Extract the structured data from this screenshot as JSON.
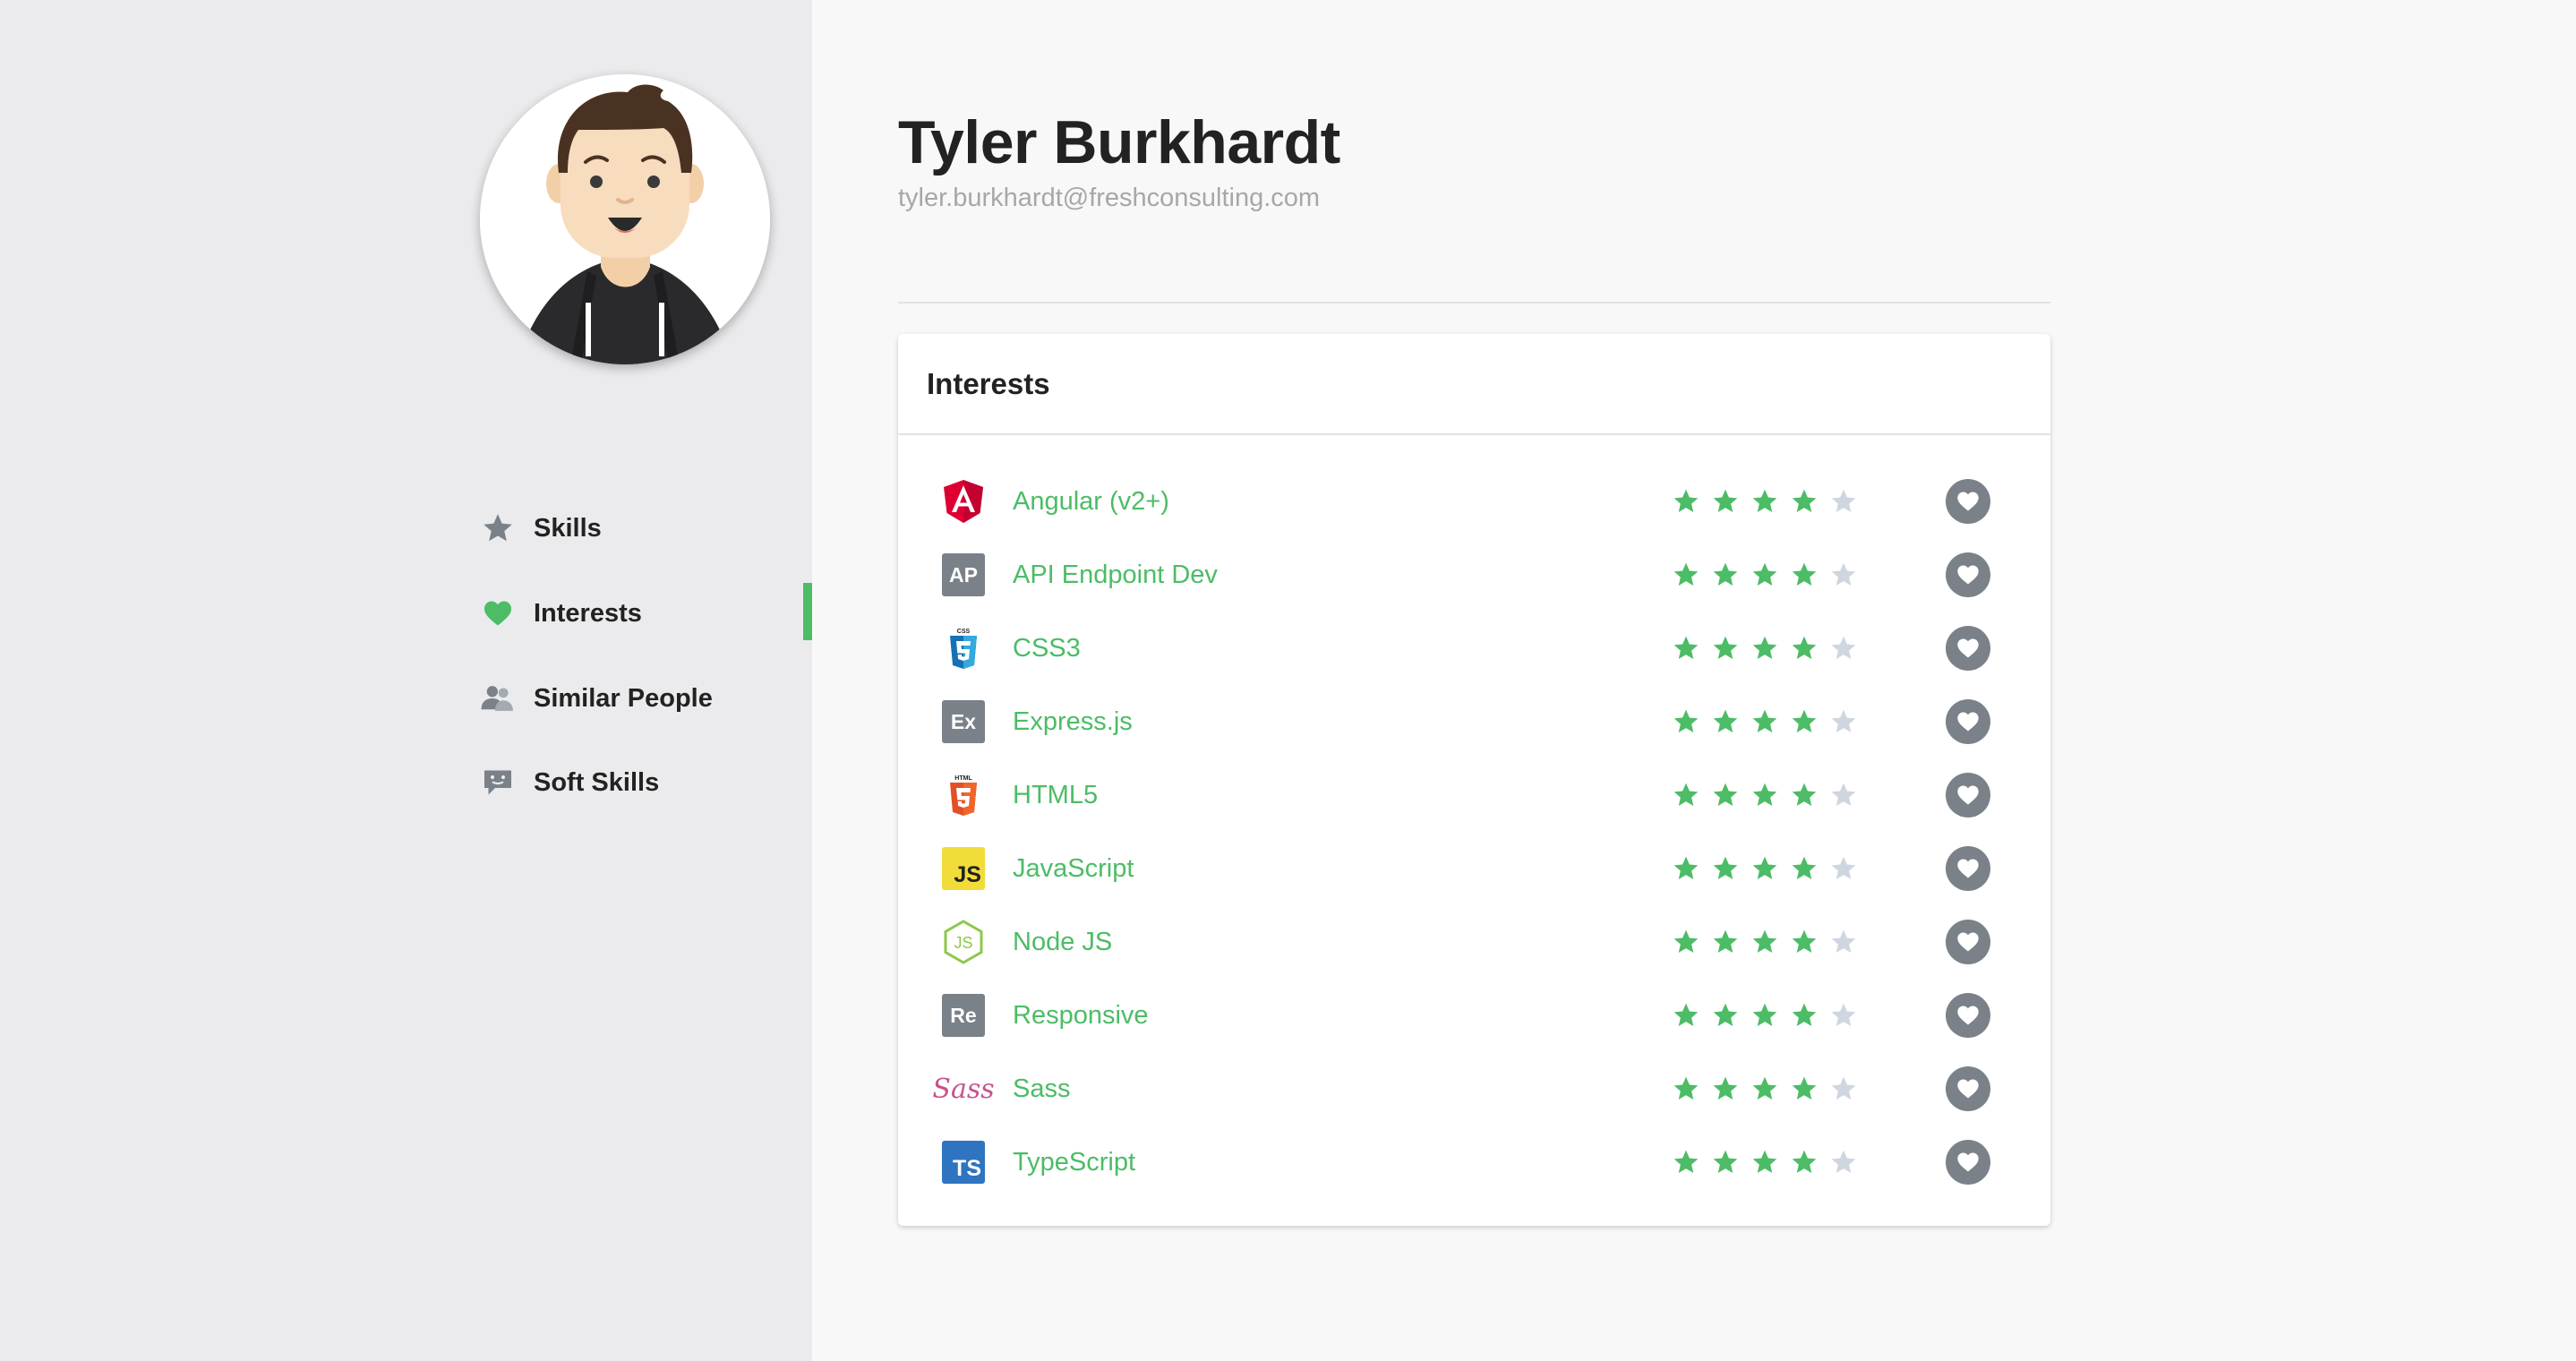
{
  "profile": {
    "name": "Tyler Burkhardt",
    "email": "tyler.burkhardt@freshconsulting.com"
  },
  "nav": {
    "items": [
      {
        "label": "Skills",
        "icon": "star-icon"
      },
      {
        "label": "Interests",
        "icon": "heart-icon",
        "active": true
      },
      {
        "label": "Similar People",
        "icon": "people-icon"
      },
      {
        "label": "Soft Skills",
        "icon": "chat-icon"
      }
    ]
  },
  "interests": {
    "title": "Interests",
    "items": [
      {
        "name": "Angular (v2+)",
        "icon": "angular-icon",
        "rating": 4,
        "max": 5
      },
      {
        "name": "API Endpoint Dev",
        "icon": "ap-badge",
        "badge": "AP",
        "rating": 4,
        "max": 5
      },
      {
        "name": "CSS3",
        "icon": "css3-icon",
        "icon_text": "CSS",
        "rating": 4,
        "max": 5
      },
      {
        "name": "Express.js",
        "icon": "ex-badge",
        "badge": "Ex",
        "rating": 4,
        "max": 5
      },
      {
        "name": "HTML5",
        "icon": "html5-icon",
        "icon_text": "HTML",
        "rating": 4,
        "max": 5
      },
      {
        "name": "JavaScript",
        "icon": "js-badge",
        "badge": "JS",
        "rating": 4,
        "max": 5
      },
      {
        "name": "Node JS",
        "icon": "nodejs-icon",
        "icon_text": "JS",
        "rating": 4,
        "max": 5
      },
      {
        "name": "Responsive",
        "icon": "re-badge",
        "badge": "Re",
        "rating": 4,
        "max": 5
      },
      {
        "name": "Sass",
        "icon": "sass-icon",
        "icon_text": "Sass",
        "rating": 4,
        "max": 5
      },
      {
        "name": "TypeScript",
        "icon": "ts-badge",
        "badge": "TS",
        "rating": 4,
        "max": 5
      }
    ]
  },
  "colors": {
    "accent": "#4cbc66",
    "star_empty": "#cfd6e0",
    "icon_gray": "#7a8189"
  }
}
